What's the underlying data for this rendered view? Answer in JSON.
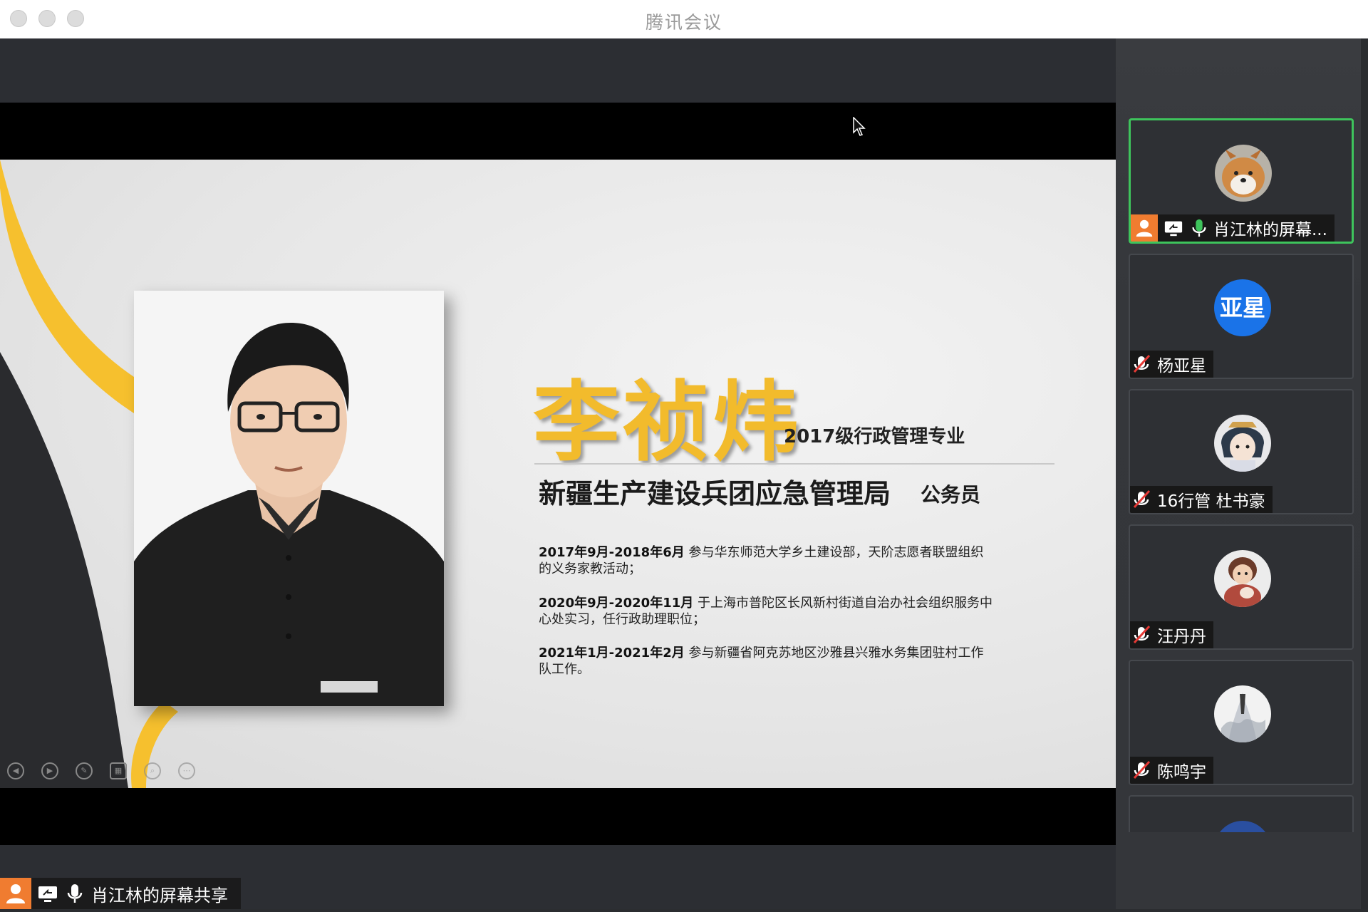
{
  "window": {
    "title": "腾讯会议"
  },
  "slide": {
    "name": "李祯炜",
    "major": "2017级行政管理专业",
    "organization": "新疆生产建设兵团应急管理局",
    "role": "公务员",
    "experiences": [
      {
        "period": "2017年9月-2018年6月",
        "text": " 参与华东师范大学乡土建设部，天阶志愿者联盟组织的义务家教活动；"
      },
      {
        "period": "2020年9月-2020年11月",
        "text": " 于上海市普陀区长风新村街道自治办社会组织服务中心处实习，任行政助理职位；"
      },
      {
        "period": "2021年1月-2021年2月",
        "text": " 参与新疆省阿克苏地区沙雅县兴雅水务集团驻村工作队工作。"
      }
    ]
  },
  "presenter": {
    "label": "肖江林的屏幕共享"
  },
  "participants": [
    {
      "name": "肖江林的屏幕...",
      "avatar": "shiba-dog-avatar",
      "mic": "on",
      "active": true
    },
    {
      "name": "杨亚星",
      "avatar_text": "亚星",
      "mic": "muted",
      "active": false
    },
    {
      "name": "16行管 杜书豪",
      "avatar": "anime-avatar",
      "mic": "muted",
      "active": false
    },
    {
      "name": "汪丹丹",
      "avatar": "cartoon-avatar",
      "mic": "muted",
      "active": false
    },
    {
      "name": "陈鸣宇",
      "avatar": "figure-avatar",
      "mic": "muted",
      "active": false
    }
  ],
  "colors": {
    "active_border": "#3ec45c",
    "accent_yellow": "#f2bb2c",
    "avatar_blue": "#1a73e8",
    "presenter_orange": "#f07c30"
  }
}
